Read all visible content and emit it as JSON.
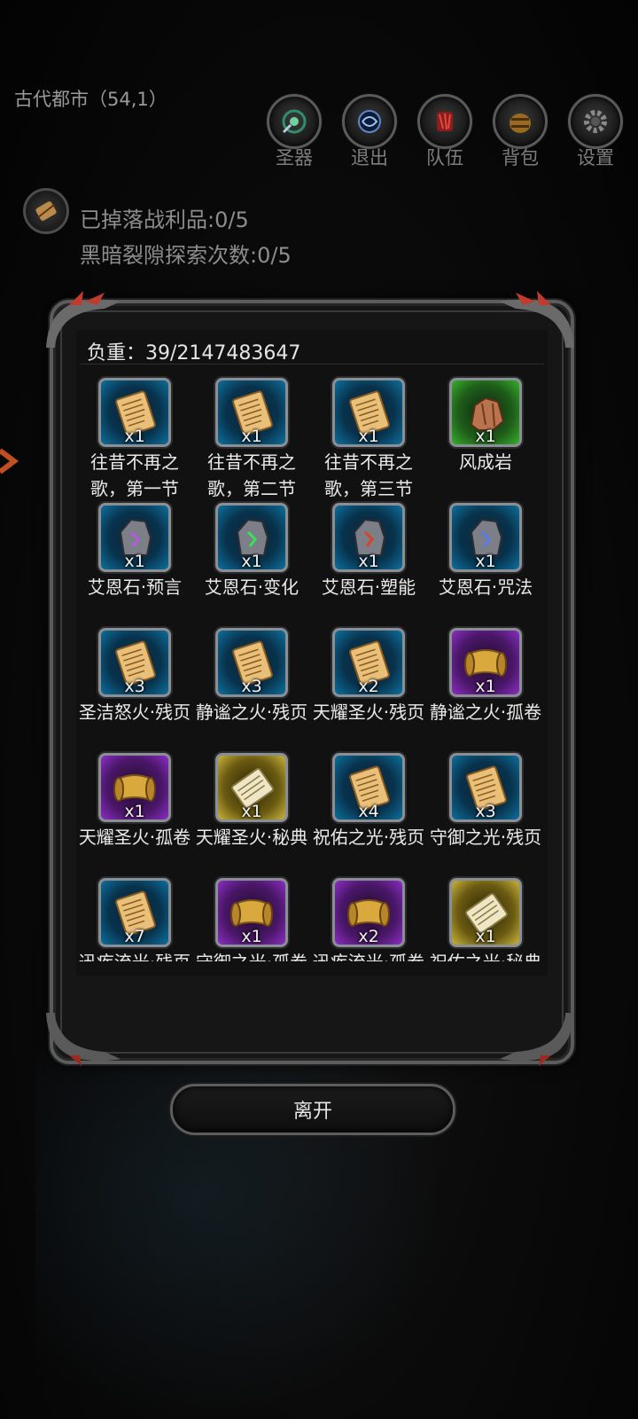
{
  "location": "古代都市（54,1）",
  "menu": [
    {
      "label": "圣器",
      "icon": "relic-icon"
    },
    {
      "label": "退出",
      "icon": "portal-icon"
    },
    {
      "label": "队伍",
      "icon": "team-icon"
    },
    {
      "label": "背包",
      "icon": "backpack-icon"
    },
    {
      "label": "设置",
      "icon": "gear-icon"
    }
  ],
  "status": {
    "loot": "已掉落战利品:0/5",
    "explore": "黑暗裂隙探索次数:0/5"
  },
  "inventory": {
    "weight": "负重：39/2147483647",
    "items": [
      {
        "name": "往昔不再之歌，第一节",
        "qty": "x1",
        "rarity": "blue",
        "icon": "page-icon"
      },
      {
        "name": "往昔不再之歌，第二节",
        "qty": "x1",
        "rarity": "blue",
        "icon": "page-icon"
      },
      {
        "name": "往昔不再之歌，第三节",
        "qty": "x1",
        "rarity": "blue",
        "icon": "page-icon"
      },
      {
        "name": "风成岩",
        "qty": "x1",
        "rarity": "green",
        "icon": "rock-icon"
      },
      {
        "name": "艾恩石·预言",
        "qty": "x1",
        "rarity": "blue",
        "icon": "rune-stone-icon"
      },
      {
        "name": "艾恩石·变化",
        "qty": "x1",
        "rarity": "blue",
        "icon": "rune-stone-icon"
      },
      {
        "name": "艾恩石·塑能",
        "qty": "x1",
        "rarity": "blue",
        "icon": "rune-stone-icon"
      },
      {
        "name": "艾恩石·咒法",
        "qty": "x1",
        "rarity": "blue",
        "icon": "rune-stone-icon"
      },
      {
        "name": "圣洁怒火·残页",
        "qty": "x3",
        "rarity": "blue",
        "icon": "page-icon"
      },
      {
        "name": "静谧之火·残页",
        "qty": "x3",
        "rarity": "blue",
        "icon": "page-icon"
      },
      {
        "name": "天耀圣火·残页",
        "qty": "x2",
        "rarity": "blue",
        "icon": "page-icon"
      },
      {
        "name": "静谧之火·孤卷",
        "qty": "x1",
        "rarity": "purple",
        "icon": "scroll-icon"
      },
      {
        "name": "天耀圣火·孤卷",
        "qty": "x1",
        "rarity": "purple",
        "icon": "scroll-icon"
      },
      {
        "name": "天耀圣火·秘典",
        "qty": "x1",
        "rarity": "gold",
        "icon": "tome-scroll-icon"
      },
      {
        "name": "祝佑之光·残页",
        "qty": "x4",
        "rarity": "blue",
        "icon": "page-icon"
      },
      {
        "name": "守御之光·残页",
        "qty": "x3",
        "rarity": "blue",
        "icon": "page-icon"
      },
      {
        "name": "迅疾流光·残页",
        "qty": "x7",
        "rarity": "blue",
        "icon": "page-icon"
      },
      {
        "name": "守御之光·孤卷",
        "qty": "x1",
        "rarity": "purple",
        "icon": "scroll-icon"
      },
      {
        "name": "迅疾流光·孤卷",
        "qty": "x2",
        "rarity": "purple",
        "icon": "scroll-icon"
      },
      {
        "name": "祝佑之光·秘典",
        "qty": "x1",
        "rarity": "gold",
        "icon": "tome-scroll-icon"
      }
    ]
  },
  "leave_label": "离开",
  "colors": {
    "blue_slot": "#0d6f9c",
    "green_slot": "#35b02a",
    "purple_slot": "#8c2ec4",
    "gold_slot": "#c9b43a"
  }
}
